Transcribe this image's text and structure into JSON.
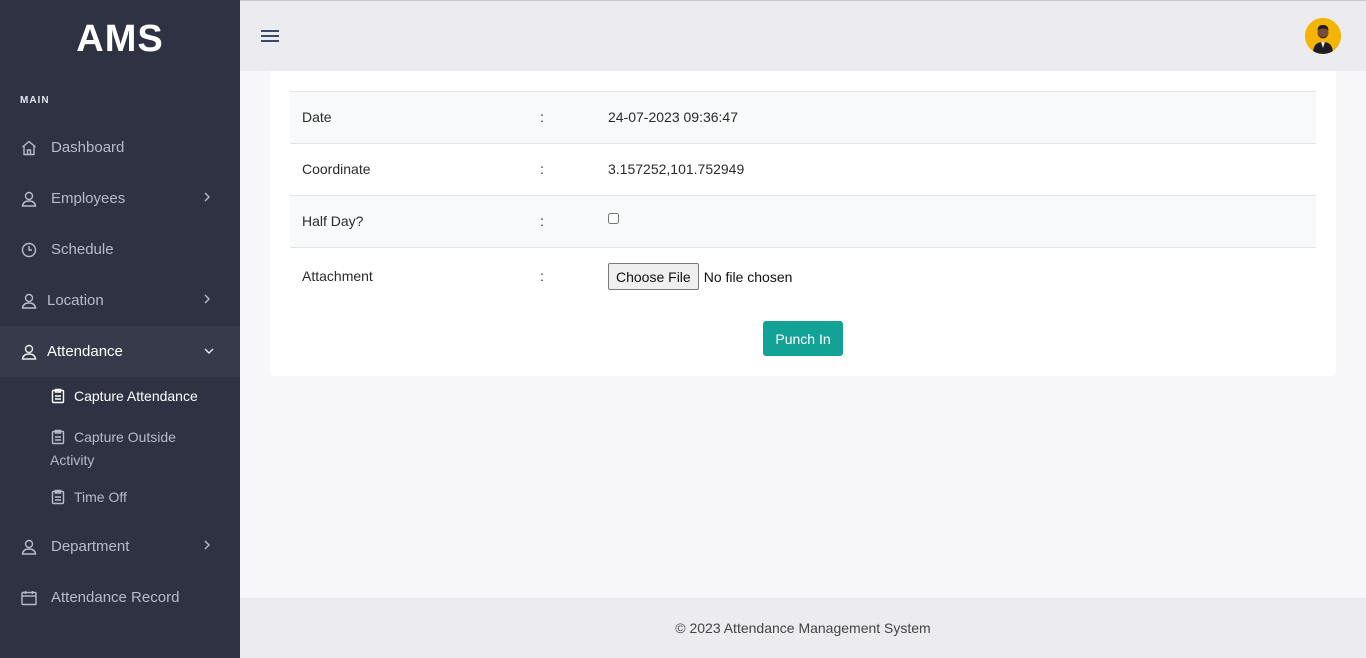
{
  "brand": "AMS",
  "sidebar": {
    "section_label": "MAIN",
    "items": [
      {
        "label": "Dashboard",
        "icon": "home-icon"
      },
      {
        "label": "Employees",
        "icon": "user-icon",
        "has_children": true
      },
      {
        "label": "Schedule",
        "icon": "clock-icon"
      },
      {
        "label": "Location",
        "icon": "user-icon",
        "has_children": true
      },
      {
        "label": "Attendance",
        "icon": "user-icon",
        "expanded": true
      },
      {
        "label": "Department",
        "icon": "user-icon",
        "has_children": true
      },
      {
        "label": "Attendance Record",
        "icon": "calendar-icon"
      }
    ],
    "attendance_sub": [
      {
        "label": "Capture Attendance",
        "icon": "clipboard-icon",
        "active": true
      },
      {
        "label": "Capture Outside Activity",
        "icon": "clipboard-icon"
      },
      {
        "label": "Time Off",
        "icon": "clipboard-icon"
      }
    ]
  },
  "form": {
    "rows": [
      {
        "label": "Date",
        "separator": ":",
        "value": "24-07-2023 09:36:47"
      },
      {
        "label": "Coordinate",
        "separator": ":",
        "value": "3.157252,101.752949"
      },
      {
        "label": "Half Day?",
        "separator": ":",
        "checked": false
      },
      {
        "label": "Attachment",
        "separator": ":"
      }
    ],
    "file_button": "Choose File",
    "file_status": "No file chosen",
    "submit_label": "Punch In"
  },
  "footer": {
    "text": "© 2023 Attendance Management System"
  },
  "colors": {
    "sidebar_bg": "#2f3242",
    "accent": "#12a396",
    "avatar_bg": "#f4b400"
  }
}
